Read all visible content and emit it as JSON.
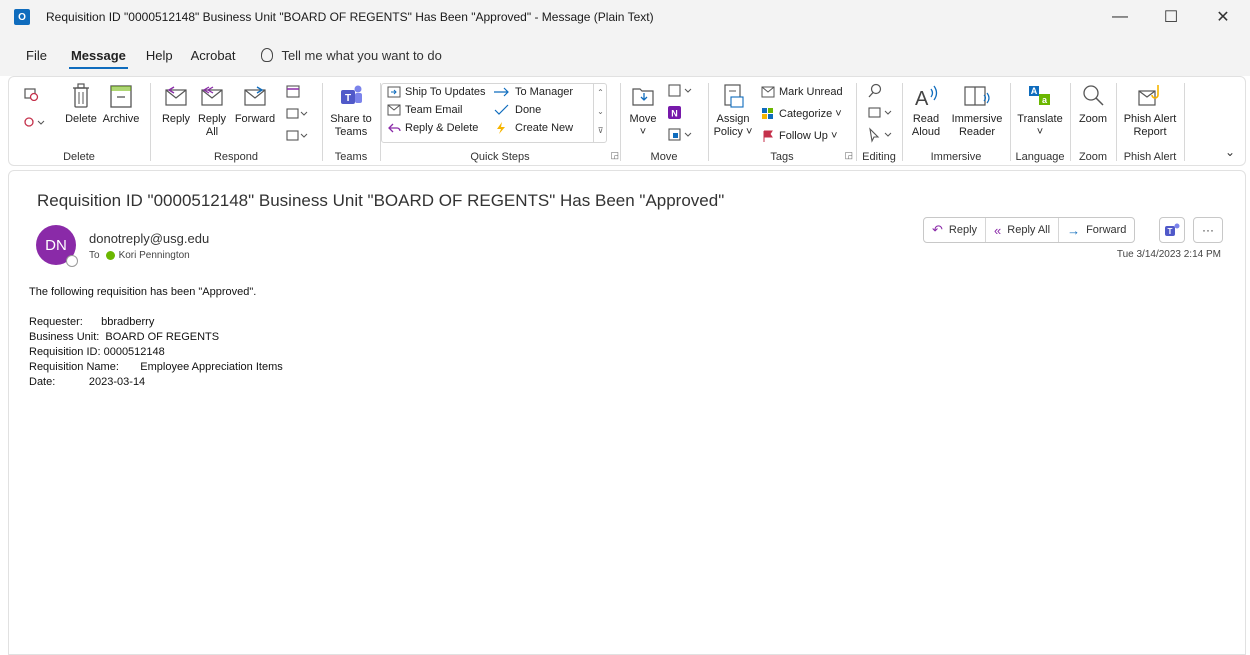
{
  "window": {
    "title": "Requisition ID \"0000512148\" Business Unit \"BOARD OF REGENTS\" Has Been \"Approved\"  -  Message (Plain Text)",
    "app_icon_label": "O",
    "minimize": "—",
    "maximize": "☐",
    "close": "✕"
  },
  "menu": {
    "items": [
      "File",
      "Message",
      "Help",
      "Acrobat"
    ],
    "active": "Message",
    "tell_me": "Tell me what you want to do"
  },
  "ribbon": {
    "groups": {
      "delete": {
        "label": "Delete",
        "delete": "Delete",
        "archive": "Archive"
      },
      "respond": {
        "label": "Respond",
        "reply": "Reply",
        "reply_all_1": "Reply",
        "reply_all_2": "All",
        "forward": "Forward"
      },
      "teams": {
        "label": "Teams",
        "share_1": "Share to",
        "share_2": "Teams"
      },
      "quick_steps": {
        "label": "Quick Steps",
        "items": [
          "Ship To Updates",
          "Team Email",
          "Reply & Delete",
          "To Manager",
          "Done",
          "Create New"
        ]
      },
      "move": {
        "label": "Move",
        "move": "Move"
      },
      "tags": {
        "label": "Tags",
        "assign_1": "Assign",
        "assign_2": "Policy ˅",
        "mark_unread": "Mark Unread",
        "categorize": "Categorize ˅",
        "follow_up": "Follow Up ˅"
      },
      "editing": {
        "label": "Editing"
      },
      "immersive": {
        "label": "Immersive",
        "read_1": "Read",
        "read_2": "Aloud",
        "immersive_1": "Immersive",
        "immersive_2": "Reader"
      },
      "language": {
        "label": "Language",
        "translate": "Translate",
        "translate_caret": "˅"
      },
      "zoom": {
        "label": "Zoom",
        "zoom": "Zoom"
      },
      "phish": {
        "label": "Phish Alert",
        "btn_1": "Phish Alert",
        "btn_2": "Report"
      }
    },
    "accent_color": "#0f6cbd"
  },
  "message": {
    "subject": "Requisition ID \"0000512148\" Business Unit \"BOARD OF REGENTS\" Has Been \"Approved\"",
    "avatar_initials": "DN",
    "avatar_color": "#8a2aa8",
    "from": "donotreply@usg.edu",
    "to_label": "To",
    "to": "Kori Pennington",
    "date": "Tue 3/14/2023 2:14 PM",
    "actions": {
      "reply": "Reply",
      "reply_all": "Reply All",
      "forward": "Forward",
      "more": "···"
    },
    "body": {
      "intro": "The following requisition has been \"Approved\".",
      "lines": [
        "Requester:      bbradberry",
        "Business Unit:  BOARD OF REGENTS",
        "Requisition ID: 0000512148",
        "Requisition Name:       Employee Appreciation Items",
        "Date:           2023-03-14"
      ]
    }
  }
}
